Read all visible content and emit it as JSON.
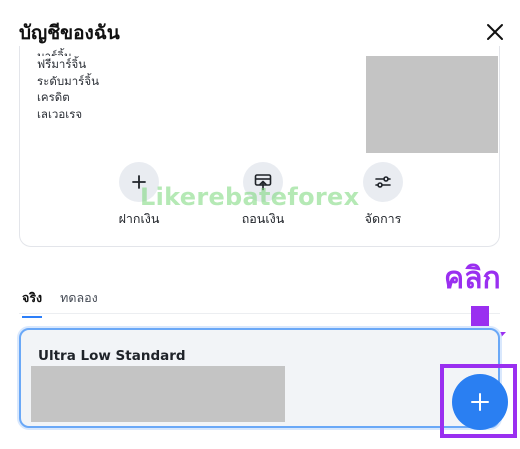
{
  "header": {
    "title": "บัญชีของฉัน"
  },
  "account_info": {
    "labels": [
      "มาร์จิ้น",
      "ฟรีมาร์จิ้น",
      "ระดับมาร์จิ้น",
      "เครดิต",
      "เลเวอเรจ"
    ]
  },
  "actions": {
    "deposit": "ฝากเงิน",
    "withdraw": "ถอนเงิน",
    "manage": "จัดการ"
  },
  "watermark": "Likerebateforex",
  "tabs": {
    "real": "จริง",
    "demo": "ทดลอง"
  },
  "account": {
    "name": "Ultra Low Standard"
  },
  "annotation": {
    "text": "คลิก"
  },
  "colors": {
    "accent": "#2a7ff2",
    "annotation": "#9a2ff0"
  },
  "icons": {
    "close": "close-icon",
    "deposit": "plus-icon",
    "withdraw": "withdraw-icon",
    "manage": "sliders-icon",
    "add": "plus-icon"
  }
}
